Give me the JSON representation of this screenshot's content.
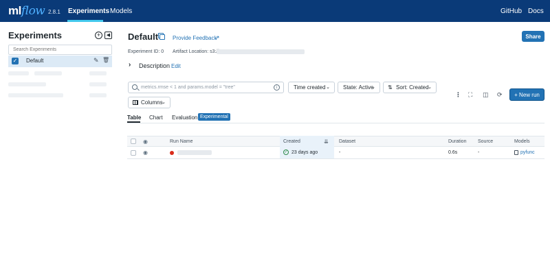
{
  "nav": {
    "logo_ml": "ml",
    "logo_flow": "flow",
    "version": "2.8.1",
    "items": [
      {
        "label": "Experiments",
        "active": true
      },
      {
        "label": "Models",
        "active": false
      }
    ],
    "right": [
      {
        "label": "GitHub"
      },
      {
        "label": "Docs"
      }
    ]
  },
  "sidebar": {
    "title": "Experiments",
    "search_placeholder": "Search Experiments",
    "experiments": [
      {
        "name": "Default",
        "selected": true
      }
    ]
  },
  "header": {
    "title": "Default",
    "feedback_link": "Provide Feedback",
    "share_label": "Share",
    "experiment_id_label": "Experiment ID: 0",
    "artifact_location_label": "Artifact Location: s3://",
    "description_label": "Description",
    "description_edit": "Edit"
  },
  "toolbar": {
    "search_placeholder": "metrics.rmse < 1 and params.model = \"tree\"",
    "time_filter": "Time created",
    "state_filter": "State: Active",
    "sort": "Sort: Created",
    "columns": "Columns",
    "new_run": "New run"
  },
  "tabs": [
    {
      "label": "Table",
      "active": true
    },
    {
      "label": "Chart",
      "active": false
    },
    {
      "label": "Evaluation",
      "active": false
    }
  ],
  "experimental_badge": "Experimental",
  "table": {
    "columns": [
      "Run Name",
      "Created",
      "Dataset",
      "Duration",
      "Source",
      "Models"
    ],
    "rows": [
      {
        "run_name": "",
        "created": "23 days ago",
        "dataset": "-",
        "duration": "0.6s",
        "source": "-",
        "model": "pyfunc"
      }
    ]
  },
  "colors": {
    "nav_bg": "#0a3a78",
    "accent": "#2272b4",
    "selected_bg": "#dceaf6",
    "run_status": "#d92c1b"
  }
}
